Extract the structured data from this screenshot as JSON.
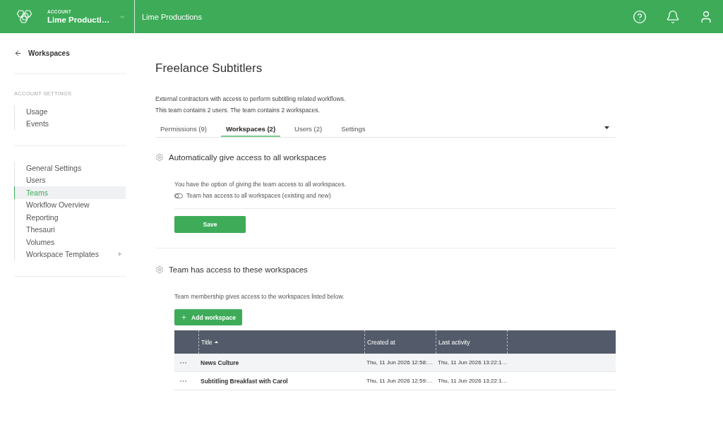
{
  "header": {
    "account_label": "ACCOUNT",
    "account_name": "Lime Producti…",
    "title": "Lime Productions"
  },
  "sidebar": {
    "back_link": "Workspaces",
    "section_label": "ACCOUNT SETTINGS",
    "groups": [
      {
        "items": [
          {
            "label": "Usage",
            "selected": false,
            "has_submenu": false
          },
          {
            "label": "Events",
            "selected": false,
            "has_submenu": false
          }
        ]
      },
      {
        "items": [
          {
            "label": "General Settings",
            "selected": false,
            "has_submenu": false
          },
          {
            "label": "Users",
            "selected": false,
            "has_submenu": false
          },
          {
            "label": "Teams",
            "selected": true,
            "has_submenu": false
          },
          {
            "label": "Workflow Overview",
            "selected": false,
            "has_submenu": false
          },
          {
            "label": "Reporting",
            "selected": false,
            "has_submenu": false
          },
          {
            "label": "Thesauri",
            "selected": false,
            "has_submenu": false
          },
          {
            "label": "Volumes",
            "selected": false,
            "has_submenu": false
          },
          {
            "label": "Workspace Templates",
            "selected": false,
            "has_submenu": true
          }
        ]
      }
    ]
  },
  "page": {
    "title": "Freelance Subtitlers",
    "description": [
      "External contractors with access to perform subtitling related workflows.",
      "This team contains 2 users. The team contains 2 workspaces."
    ]
  },
  "tabs": [
    {
      "label": "Permissions (9)",
      "selected": false
    },
    {
      "label": "Workspaces (2)",
      "selected": true
    },
    {
      "label": "Users (2)",
      "selected": false
    },
    {
      "label": "Settings",
      "selected": false
    }
  ],
  "sections": [
    {
      "kind": "toggle",
      "title": "Automatically give access to all workspaces",
      "description": "You have the option of giving the team access to all workspaces.",
      "toggle": {
        "label": "Team has access to all workspaces (existing and new)",
        "on": false
      },
      "button": "Save"
    },
    {
      "kind": "table",
      "title": "Team has access to these workspaces",
      "description": "Team membership gives access to the workspaces listed below.",
      "button": "Add workspace",
      "table": {
        "columns": [
          {
            "label": "Title",
            "sorted": true
          },
          {
            "label": "Created at",
            "sorted": false
          },
          {
            "label": "Last activity",
            "sorted": false
          }
        ],
        "rows": [
          {
            "title": "News Culture",
            "created_at": "Thu, 11 Jun 2026 12:58:…",
            "last_activity": "Thu, 11 Jun 2026 13:22:1…",
            "highlighted": true
          },
          {
            "title": "Subtitling Breakfast with Carol",
            "created_at": "Thu, 11 Jun 2026 12:59:…",
            "last_activity": "Thu, 11 Jun 2026 13:22:1…",
            "highlighted": false
          }
        ]
      }
    }
  ]
}
